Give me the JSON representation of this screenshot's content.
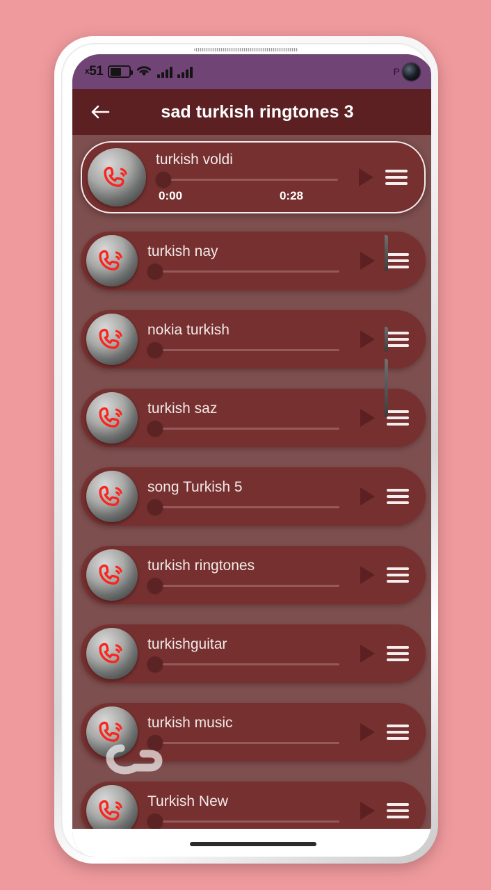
{
  "theme": {
    "page_background": "#ef9b9e",
    "status_bar_color": "#714476",
    "app_bar_color": "#5c2022",
    "screen_background": "#7d4f4f",
    "card_color": "#76302f",
    "accent_red": "#f9251f",
    "text_color": "#f2e9e9"
  },
  "status_bar": {
    "battery_text": "51",
    "battery_prefix": "x",
    "battery_icon": "battery-icon",
    "wifi_icon": "wifi-icon",
    "signal_icon_1": "signal-bars-icon",
    "signal_icon_2": "signal-bars-icon",
    "right_glyph": "P",
    "camera_icon": "front-camera-punchhole-icon"
  },
  "app_bar": {
    "back_icon": "back-arrow-icon",
    "title": "sad turkish ringtones 3"
  },
  "list": {
    "play_icon": "play-icon",
    "menu_icon": "hamburger-menu-icon",
    "ringtone_icon": "ringtone-phone-icon",
    "watermark_icon": "phone-handset-watermark-icon",
    "items": [
      {
        "title": "turkish voldi",
        "selected": true,
        "current_time": "0:00",
        "total_time": "0:28",
        "progress": 0
      },
      {
        "title": "turkish nay",
        "selected": false,
        "progress": 0
      },
      {
        "title": "nokia turkish",
        "selected": false,
        "progress": 0
      },
      {
        "title": "turkish saz",
        "selected": false,
        "progress": 0
      },
      {
        "title": "song Turkish 5",
        "selected": false,
        "progress": 0
      },
      {
        "title": "turkish ringtones",
        "selected": false,
        "progress": 0
      },
      {
        "title": "turkishguitar",
        "selected": false,
        "progress": 0
      },
      {
        "title": "turkish music",
        "selected": false,
        "progress": 0
      },
      {
        "title": "Turkish New",
        "selected": false,
        "progress": 0
      }
    ]
  },
  "nav_bar": {
    "gesture_pill": "gesture-home-pill"
  }
}
